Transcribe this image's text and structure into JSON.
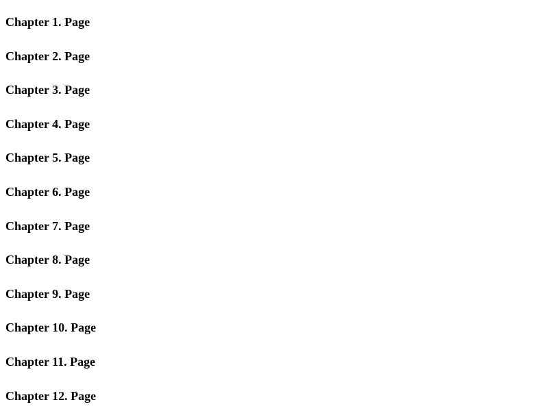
{
  "chapters": [
    {
      "label": "Chapter 1. Page"
    },
    {
      "label": "Chapter 2. Page"
    },
    {
      "label": "Chapter 3. Page"
    },
    {
      "label": "Chapter 4. Page"
    },
    {
      "label": "Chapter 5. Page"
    },
    {
      "label": "Chapter 6. Page"
    },
    {
      "label": "Chapter 7. Page"
    },
    {
      "label": "Chapter 8. Page"
    },
    {
      "label": "Chapter 9. Page"
    },
    {
      "label": "Chapter 10. Page"
    },
    {
      "label": "Chapter 11. Page"
    },
    {
      "label": "Chapter 12. Page"
    }
  ]
}
